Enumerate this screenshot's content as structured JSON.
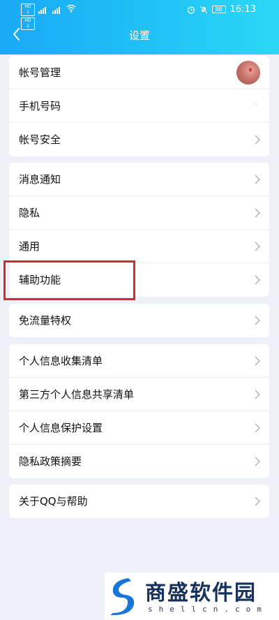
{
  "status_bar": {
    "sim1": "HD 1",
    "sim2": "HD 2",
    "network1": "5G",
    "network2": "4G",
    "battery": "88",
    "time": "16:13"
  },
  "header": {
    "title": "设置",
    "back_icon": "chevron-left-icon"
  },
  "groups": [
    {
      "items": [
        {
          "label": "帐号管理",
          "trailing": "avatar"
        },
        {
          "label": "手机号码",
          "trailing": "mark",
          "value": "`"
        },
        {
          "label": "帐号安全",
          "trailing": "chevron"
        }
      ]
    },
    {
      "items": [
        {
          "label": "消息通知",
          "trailing": "chevron"
        },
        {
          "label": "隐私",
          "trailing": "chevron"
        },
        {
          "label": "通用",
          "trailing": "chevron"
        },
        {
          "label": "辅助功能",
          "trailing": "chevron",
          "highlighted": true
        }
      ]
    },
    {
      "items": [
        {
          "label": "免流量特权",
          "trailing": "chevron"
        }
      ]
    },
    {
      "items": [
        {
          "label": "个人信息收集清单",
          "trailing": "chevron"
        },
        {
          "label": "第三方个人信息共享清单",
          "trailing": "chevron"
        },
        {
          "label": "个人信息保护设置",
          "trailing": "chevron"
        },
        {
          "label": "隐私政策摘要",
          "trailing": "chevron"
        }
      ]
    },
    {
      "items": [
        {
          "label": "关于QQ与帮助",
          "trailing": "chevron"
        }
      ]
    }
  ],
  "watermark": {
    "title": "商盛软件园",
    "url": "shellcn.com"
  },
  "colors": {
    "header_start": "#19a9f5",
    "header_end": "#2ad8f5",
    "background": "#eef1f7",
    "highlight": "#d42c2c"
  }
}
